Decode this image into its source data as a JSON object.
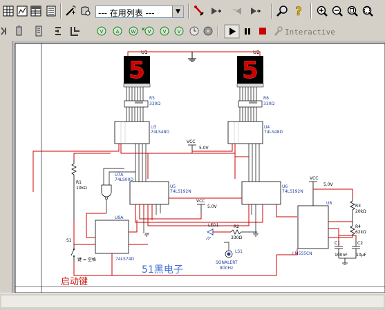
{
  "toolbar": {
    "component_list": "--- 在用列表 ---",
    "interactive_label": "Interactive"
  },
  "icons": [
    "grid-icon",
    "grapher-icon",
    "spreadsheet-icon",
    "postprocessor-icon",
    "component-wizard-icon",
    "database-icon",
    "list-dropdown",
    "probe-icon",
    "step-icon",
    "back-annotate-icon",
    "forward-annotate-icon",
    "find-icon",
    "help-icon",
    "zoom-in-icon",
    "zoom-out-icon",
    "zoom-area-icon",
    "zoom-fit-icon",
    "run-icon",
    "pause-icon",
    "stop-icon",
    "interactive-wrench-icon"
  ],
  "schematic": {
    "u1": "U1",
    "u2": "U2",
    "r5": "R5",
    "r5_val": "330Ω",
    "r6": "R6",
    "r6_val": "330Ω",
    "u3": "U3",
    "u3_part": "74LS48D",
    "u4": "U4",
    "u4_part": "74LS48D",
    "vcc_a": "VCC",
    "vcc_a_val": "5.0V",
    "vcc_b": "VCC",
    "vcc_b_val": "5.0V",
    "vcc_c": "VCC",
    "vcc_c_val": "5.0V",
    "r1": "R1",
    "r1_val": "10kΩ",
    "u7a": "U7A",
    "u7a_part": "74LS00D",
    "u5": "U5",
    "u5_part": "74LS192N",
    "u6": "U6",
    "u6_part": "74LS192N",
    "u8": "U8",
    "u8_part": "LM555CN",
    "u9a": "U9A",
    "u9a_part": "74LS74D",
    "s1": "S1",
    "s1_key": "键 = 空格",
    "led1": "LED1",
    "r2": "R2",
    "r2_val": "330Ω",
    "ls1": "LS1",
    "ls1_part": "SONALERT",
    "ls1_freq": "800Hz",
    "r3": "R3",
    "r3_val": "20kΩ",
    "r4": "R4",
    "r4_val": "62kΩ",
    "c1": "C1",
    "c1_val": "100nF",
    "c2": "C2",
    "c2_val": "10µF",
    "watermark": "51黑电子",
    "start_key": "启动键",
    "seg_digit_1": "5",
    "seg_digit_2": "5"
  }
}
